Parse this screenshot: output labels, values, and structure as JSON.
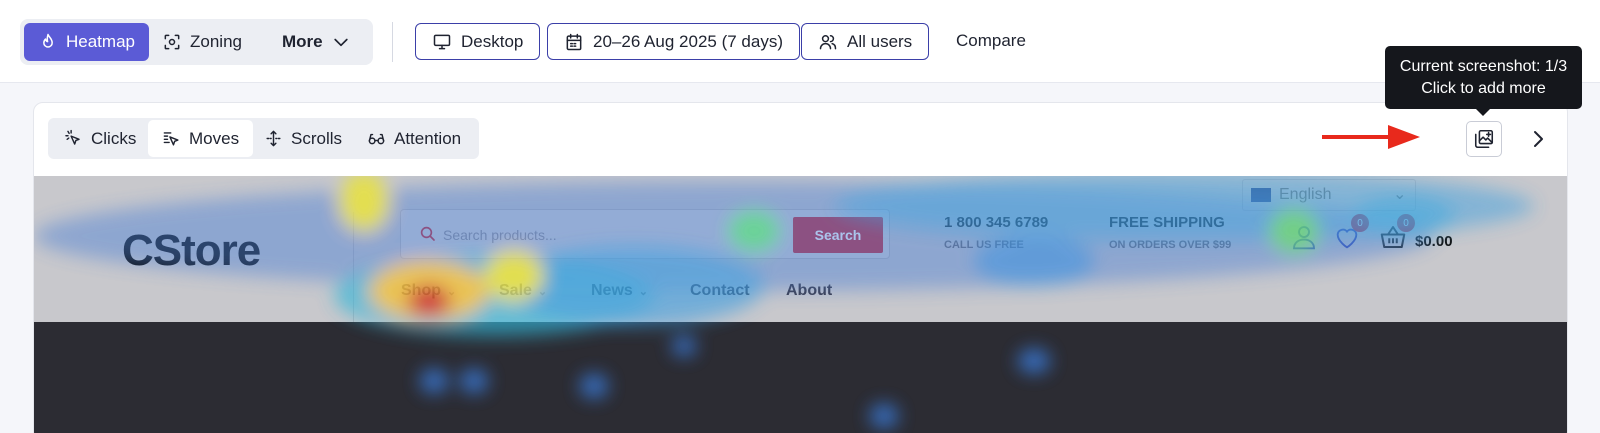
{
  "toolbar": {
    "view_modes": [
      {
        "label": "Heatmap",
        "icon": "flame-icon",
        "active": true
      },
      {
        "label": "Zoning",
        "icon": "zoning-icon",
        "active": false
      },
      {
        "label": "More",
        "icon": "chevron-down-icon",
        "active": false
      }
    ],
    "filters": {
      "device": "Desktop",
      "date_range": "20–26 Aug 2025 (7 days)",
      "segment": "All users"
    },
    "compare_label": "Compare"
  },
  "heatmap_modes": [
    {
      "label": "Clicks",
      "icon": "click-icon",
      "active": false
    },
    {
      "label": "Moves",
      "icon": "cursor-move-icon",
      "active": true
    },
    {
      "label": "Scrolls",
      "icon": "scroll-icon",
      "active": false
    },
    {
      "label": "Attention",
      "icon": "glasses-icon",
      "active": false
    }
  ],
  "screenshot_tooltip": {
    "line1": "Current screenshot: 1/3",
    "line2": "Click to add more"
  },
  "site": {
    "logo": "CStore",
    "search_placeholder": "Search products...",
    "search_button": "Search",
    "phone": "1 800 345 6789",
    "phone_sub": "CALL US FREE",
    "shipping_title": "FREE SHIPPING",
    "shipping_sub": "ON ORDERS OVER $99",
    "language": "English",
    "wishlist_count": "0",
    "cart_count": "0",
    "cart_total": "$0.00",
    "nav": [
      "Shop",
      "Sale",
      "News",
      "Contact",
      "About"
    ]
  },
  "colors": {
    "accent": "#5b5bd6",
    "filter_border": "#3b3fa8",
    "annotation_arrow": "#e8291c",
    "tooltip_bg": "#15171c"
  }
}
